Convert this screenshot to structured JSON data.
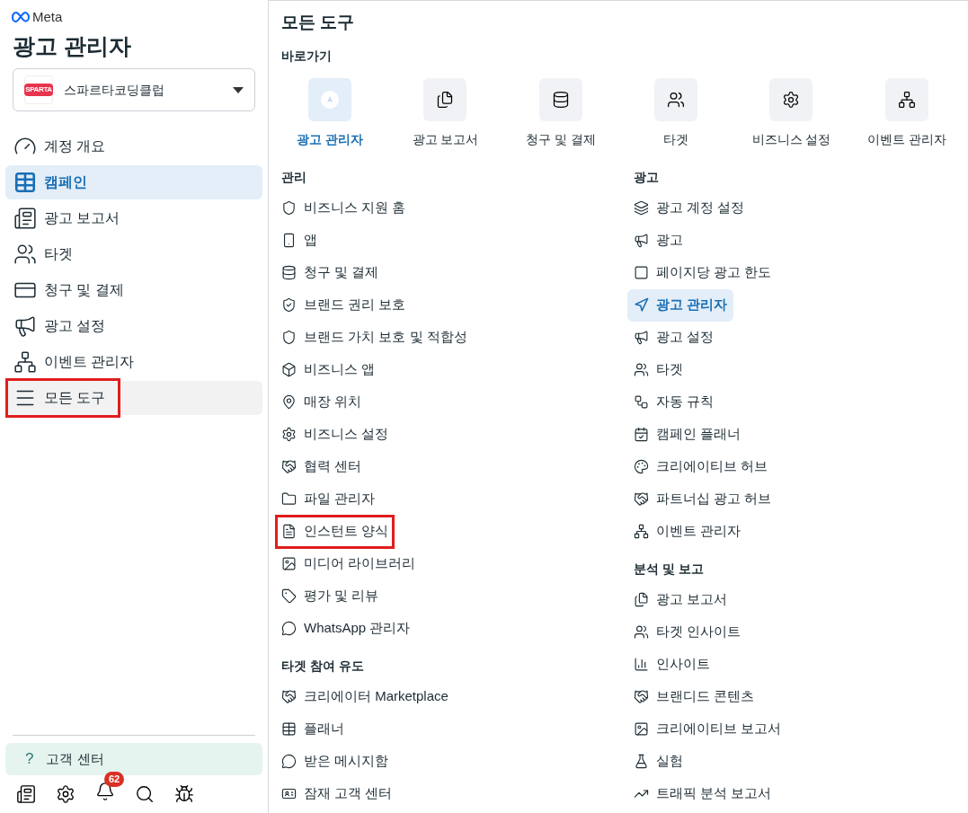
{
  "brand": "Meta",
  "app_title": "광고 관리자",
  "account": {
    "name": "스파르타코딩클럽",
    "logo_text": "SPARTA"
  },
  "nav": [
    {
      "label": "계정 개요",
      "selected": false,
      "hovered": false,
      "annotated": false
    },
    {
      "label": "캠페인",
      "selected": true,
      "hovered": false,
      "annotated": false
    },
    {
      "label": "광고 보고서",
      "selected": false,
      "hovered": false,
      "annotated": false
    },
    {
      "label": "타겟",
      "selected": false,
      "hovered": false,
      "annotated": false
    },
    {
      "label": "청구 및 결제",
      "selected": false,
      "hovered": false,
      "annotated": false
    },
    {
      "label": "광고 설정",
      "selected": false,
      "hovered": false,
      "annotated": false
    },
    {
      "label": "이벤트 관리자",
      "selected": false,
      "hovered": false,
      "annotated": false
    },
    {
      "label": "모든 도구",
      "selected": false,
      "hovered": true,
      "annotated": true
    }
  ],
  "help": {
    "icon": "?",
    "label": "고객 센터"
  },
  "notifications": {
    "count": "62"
  },
  "main": {
    "title": "모든 도구",
    "shortcuts": {
      "heading": "바로가기",
      "items": [
        {
          "label": "광고 관리자",
          "selected": true
        },
        {
          "label": "광고 보고서",
          "selected": false
        },
        {
          "label": "청구 및 결제",
          "selected": false
        },
        {
          "label": "타겟",
          "selected": false
        },
        {
          "label": "비즈니스 설정",
          "selected": false
        },
        {
          "label": "이벤트 관리자",
          "selected": false
        }
      ]
    },
    "columns": [
      [
        {
          "heading": "관리",
          "items": [
            {
              "label": "비즈니스 지원 홈",
              "selected": false,
              "annotated": false
            },
            {
              "label": "앱",
              "selected": false,
              "annotated": false
            },
            {
              "label": "청구 및 결제",
              "selected": false,
              "annotated": false
            },
            {
              "label": "브랜드 권리 보호",
              "selected": false,
              "annotated": false
            },
            {
              "label": "브랜드 가치 보호 및 적합성",
              "selected": false,
              "annotated": false
            },
            {
              "label": "비즈니스 앱",
              "selected": false,
              "annotated": false
            },
            {
              "label": "매장 위치",
              "selected": false,
              "annotated": false
            },
            {
              "label": "비즈니스 설정",
              "selected": false,
              "annotated": false
            },
            {
              "label": "협력 센터",
              "selected": false,
              "annotated": false
            },
            {
              "label": "파일 관리자",
              "selected": false,
              "annotated": false
            },
            {
              "label": "인스턴트 양식",
              "selected": false,
              "annotated": true
            },
            {
              "label": "미디어 라이브러리",
              "selected": false,
              "annotated": false
            },
            {
              "label": "평가 및 리뷰",
              "selected": false,
              "annotated": false
            },
            {
              "label": "WhatsApp 관리자",
              "selected": false,
              "annotated": false
            }
          ]
        },
        {
          "heading": "타겟 참여 유도",
          "items": [
            {
              "label": "크리에이터 Marketplace",
              "selected": false,
              "annotated": false
            },
            {
              "label": "플래너",
              "selected": false,
              "annotated": false
            },
            {
              "label": "받은 메시지함",
              "selected": false,
              "annotated": false
            },
            {
              "label": "잠재 고객 센터",
              "selected": false,
              "annotated": false
            }
          ]
        }
      ],
      [
        {
          "heading": "광고",
          "items": [
            {
              "label": "광고 계정 설정",
              "selected": false,
              "annotated": false
            },
            {
              "label": "광고",
              "selected": false,
              "annotated": false
            },
            {
              "label": "페이지당 광고 한도",
              "selected": false,
              "annotated": false
            },
            {
              "label": "광고 관리자",
              "selected": true,
              "annotated": false
            },
            {
              "label": "광고 설정",
              "selected": false,
              "annotated": false
            },
            {
              "label": "타겟",
              "selected": false,
              "annotated": false
            },
            {
              "label": "자동 규칙",
              "selected": false,
              "annotated": false
            },
            {
              "label": "캠페인 플래너",
              "selected": false,
              "annotated": false
            },
            {
              "label": "크리에이티브 허브",
              "selected": false,
              "annotated": false
            },
            {
              "label": "파트너십 광고 허브",
              "selected": false,
              "annotated": false
            },
            {
              "label": "이벤트 관리자",
              "selected": false,
              "annotated": false
            }
          ]
        },
        {
          "heading": "분석 및 보고",
          "items": [
            {
              "label": "광고 보고서",
              "selected": false,
              "annotated": false
            },
            {
              "label": "타겟 인사이트",
              "selected": false,
              "annotated": false
            },
            {
              "label": "인사이트",
              "selected": false,
              "annotated": false
            },
            {
              "label": "브랜디드 콘텐츠",
              "selected": false,
              "annotated": false
            },
            {
              "label": "크리에이티브 보고서",
              "selected": false,
              "annotated": false
            },
            {
              "label": "실험",
              "selected": false,
              "annotated": false
            },
            {
              "label": "트래픽 분석 보고서",
              "selected": false,
              "annotated": false
            }
          ]
        }
      ]
    ]
  }
}
